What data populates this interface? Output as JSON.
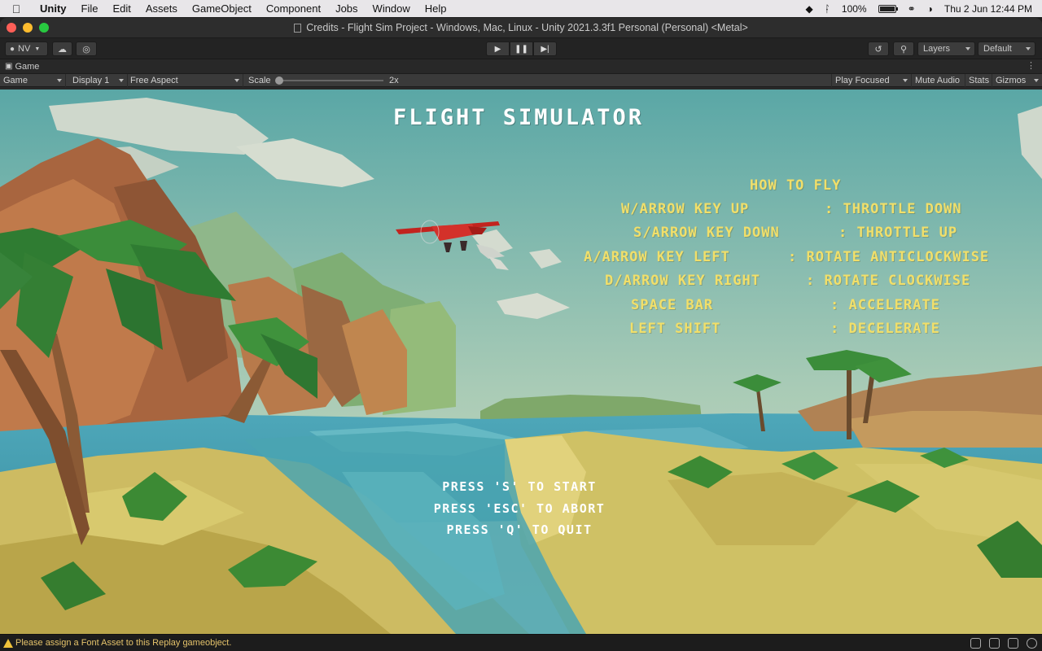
{
  "menubar": {
    "app": "Unity",
    "items": [
      "File",
      "Edit",
      "Assets",
      "GameObject",
      "Component",
      "Jobs",
      "Window",
      "Help"
    ],
    "battery_percent": "100%",
    "battery_level": 1.0,
    "clock": "Thu 2 Jun  12:44 PM"
  },
  "window": {
    "title": "Credits - Flight Sim Project - Windows, Mac, Linux - Unity 2021.3.3f1 Personal (Personal) <Metal>",
    "traffic_colors": [
      "#ff5f57",
      "#febc2e",
      "#28c840"
    ]
  },
  "toolbar": {
    "account": "NV",
    "layers": "Layers",
    "layout": "Default"
  },
  "tab": {
    "label": "Game"
  },
  "gamebar": {
    "mode": "Game",
    "display": "Display 1",
    "aspect": "Free Aspect",
    "scale_label": "Scale",
    "scale_value": "2x",
    "play_focused": "Play Focused",
    "mute": "Mute Audio",
    "stats": "Stats",
    "gizmos": "Gizmos"
  },
  "game": {
    "title": "FLIGHT SIMULATOR",
    "howto_title": "HOW TO FLY",
    "controls": [
      {
        "key": "W/ARROW KEY UP",
        "action": ": THROTTLE DOWN"
      },
      {
        "key": "S/ARROW KEY DOWN",
        "action": ": THROTTLE UP"
      },
      {
        "key": "A/ARROW KEY LEFT",
        "action": ":  ROTATE ANTICLOCKWISE"
      },
      {
        "key": "D/ARROW KEY RIGHT",
        "action": ":  ROTATE CLOCKWISE"
      },
      {
        "key": "SPACE BAR",
        "action": ":    ACCELERATE"
      },
      {
        "key": "LEFT SHIFT",
        "action": ":    DECELERATE"
      }
    ],
    "press": [
      "PRESS 'S' TO START",
      "PRESS 'ESC' TO ABORT",
      "PRESS 'Q' TO QUIT"
    ],
    "colors": {
      "howto": "#f1df6a",
      "title": "#ffffff"
    }
  },
  "status": {
    "message": "Please assign a Font Asset to this Replay gameobject."
  }
}
